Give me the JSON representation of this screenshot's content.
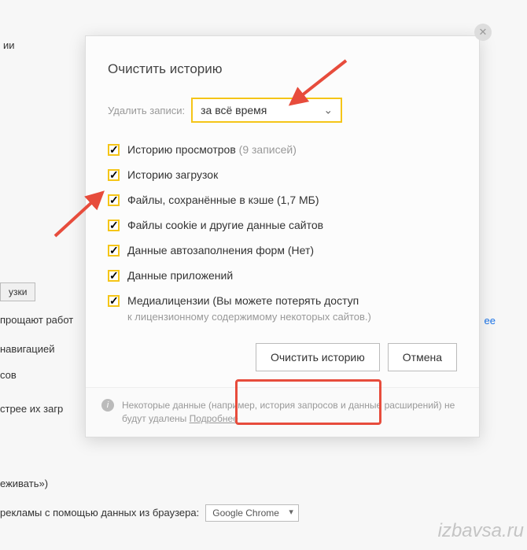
{
  "bg": {
    "frag1": "ии",
    "btn_downloads": "узки",
    "frag2": "прощают работ",
    "link_more": "ее",
    "frag3": "навигацией",
    "frag4": "сов",
    "frag5": "стрее их загр",
    "frag6": "еживать»)",
    "frag7": "рекламы с помощью данных из браузера:",
    "select_browser": "Google Chrome"
  },
  "modal": {
    "title": "Очистить историю",
    "period_label": "Удалить записи:",
    "period_value": "за всё время",
    "items": [
      {
        "label": "Историю просмотров",
        "suffix": "(9 записей)"
      },
      {
        "label": "Историю загрузок",
        "suffix": ""
      },
      {
        "label": "Файлы, сохранённые в кэше",
        "suffix": "(1,7 МБ)"
      },
      {
        "label": "Файлы cookie и другие данные сайтов",
        "suffix": ""
      },
      {
        "label": "Данные автозаполнения форм",
        "suffix": "(Нет)"
      },
      {
        "label": "Данные приложений",
        "suffix": ""
      },
      {
        "label": "Медиалицензии",
        "suffix": "(Вы можете потерять доступ"
      }
    ],
    "media_note": "к лицензионному содержимому некоторых сайтов.)",
    "clear_btn": "Очистить историю",
    "cancel_btn": "Отмена",
    "footer": "Некоторые данные (например, история запросов и данные расширений) не будут удалены ",
    "footer_link": "Подробнее"
  },
  "watermark": "izbavsa.ru"
}
